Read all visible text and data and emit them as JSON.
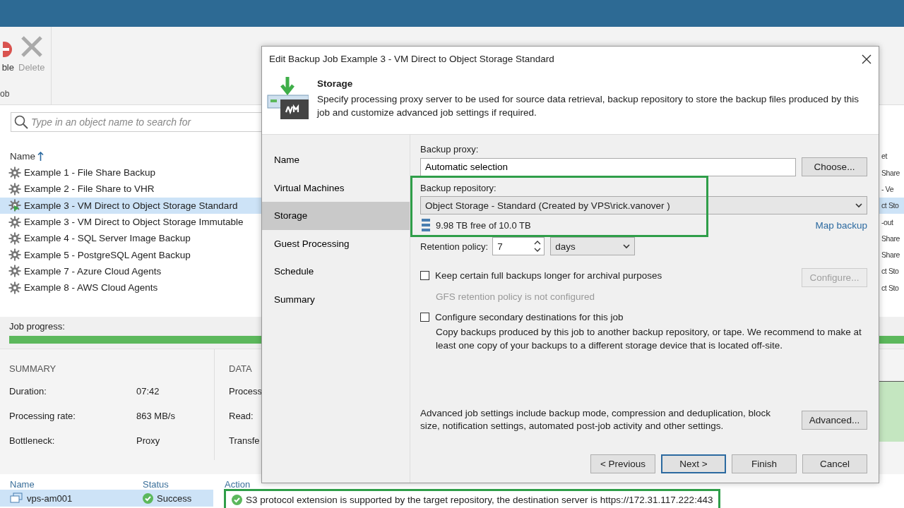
{
  "app": {
    "ribbon": {
      "buttons": [
        {
          "label": "ble",
          "kind": "disable",
          "disabled": false
        },
        {
          "label": "Delete",
          "kind": "delete",
          "disabled": true
        }
      ],
      "group_label": "ob"
    },
    "search": {
      "placeholder": "Type in an object name to search for"
    },
    "jobs": {
      "columns": [
        {
          "label": "Name",
          "sorted": true
        },
        {
          "label": "et",
          "sorted": false
        }
      ],
      "rows": [
        {
          "name": "Example 1 - File Share Backup",
          "column_2": "Share",
          "selected": false,
          "running": false
        },
        {
          "name": "Example 2 - File Share to VHR",
          "column_2": "- Ve",
          "selected": false,
          "running": false
        },
        {
          "name": "Example 3 - VM Direct to Object Storage Standard",
          "column_2": "ct Sto",
          "selected": true,
          "running": true
        },
        {
          "name": "Example 3 - VM Direct to Object Storage Immutable",
          "column_2": "-out",
          "selected": false,
          "running": false
        },
        {
          "name": "Example 4 - SQL Server Image Backup",
          "column_2": "Share",
          "selected": false,
          "running": false
        },
        {
          "name": "Example 5 - PostgreSQL Agent Backup",
          "column_2": "Share",
          "selected": false,
          "running": false
        },
        {
          "name": "Example 7 - Azure Cloud Agents",
          "column_2": "ct Sto",
          "selected": false,
          "running": false
        },
        {
          "name": "Example 8 - AWS Cloud Agents",
          "column_2": "ct Sto",
          "selected": false,
          "running": false
        }
      ]
    },
    "job_progress": {
      "label": "Job progress:",
      "level": 1
    },
    "summary": {
      "title": "SUMMARY",
      "rows": [
        {
          "label": "Duration:",
          "value": "07:42"
        },
        {
          "label": "Processing rate:",
          "value": "863 MB/s"
        },
        {
          "label": "Bottleneck:",
          "value": "Proxy"
        }
      ]
    },
    "data": {
      "title": "DATA",
      "labels": [
        "Process",
        "Read:",
        "Transfe"
      ]
    },
    "sessions": {
      "columns": [
        "Name",
        "Status",
        "Action"
      ],
      "rows": [
        {
          "name": "vps-am001",
          "status": "Success",
          "selected": true
        }
      ],
      "action": {
        "text": "S3 protocol extension is supported by the target repository, the destination server is https://172.31.117.222:443",
        "highlighted": true
      }
    }
  },
  "dialog": {
    "title": "Edit Backup Job Example 3 - VM Direct to Object Storage Standard",
    "header": {
      "title": "Storage",
      "description": "Specify processing proxy server to be used for source data retrieval, backup repository to store the backup files produced by this job and customize advanced job settings if required."
    },
    "steps": [
      {
        "label": "Name",
        "selected": false
      },
      {
        "label": "Virtual Machines",
        "selected": false
      },
      {
        "label": "Storage",
        "selected": true
      },
      {
        "label": "Guest Processing",
        "selected": false
      },
      {
        "label": "Schedule",
        "selected": false
      },
      {
        "label": "Summary",
        "selected": false
      }
    ],
    "proxy": {
      "label": "Backup proxy:",
      "value": "Automatic selection",
      "button": "Choose..."
    },
    "repository": {
      "label": "Backup repository:",
      "value": "Object Storage - Standard (Created by VPS\\rick.vanover )",
      "free": "9.98 TB free of 10.0 TB",
      "link": "Map backup",
      "highlighted": true
    },
    "retention": {
      "label": "Retention policy:",
      "value": "7",
      "unit": "days"
    },
    "options": [
      {
        "label": "Keep certain full backups longer for archival purposes",
        "checked": false,
        "note": "GFS retention policy is not configured",
        "note_disabled": true,
        "button": "Configure...",
        "button_disabled": true
      },
      {
        "label": "Configure secondary destinations for this job",
        "checked": false,
        "note": "Copy backups produced by this job to another backup repository, or tape. We recommend to make at least one copy of your backups to a different storage device that is located off-site.",
        "note_disabled": false
      }
    ],
    "advanced": {
      "text": "Advanced job settings include backup mode, compression and deduplication, block size, notification settings, automated post-job activity and other settings.",
      "button": "Advanced..."
    },
    "buttons": [
      {
        "label": "< Previous",
        "default": false
      },
      {
        "label": "Next >",
        "default": true
      },
      {
        "label": "Finish",
        "default": false
      },
      {
        "label": "Cancel",
        "default": false
      }
    ]
  }
}
